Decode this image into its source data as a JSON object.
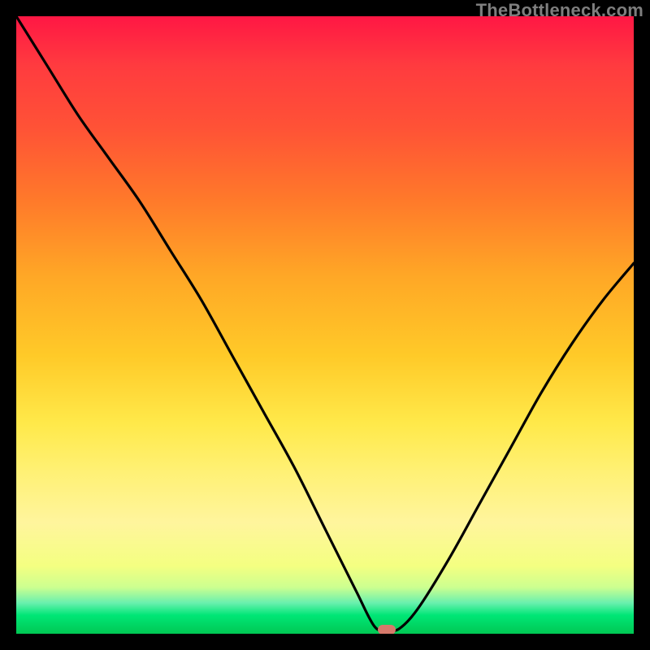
{
  "watermark": "TheBottleneck.com",
  "marker": {
    "x_pct": 60.0,
    "y_pct": 99.4,
    "color": "#d6796b"
  },
  "chart_data": {
    "type": "line",
    "title": "",
    "xlabel": "",
    "ylabel": "",
    "xlim": [
      0,
      100
    ],
    "ylim": [
      0,
      100
    ],
    "grid": false,
    "legend": false,
    "series": [
      {
        "name": "bottleneck-curve",
        "x": [
          0,
          5,
          10,
          15,
          20,
          25,
          30,
          35,
          40,
          45,
          50,
          55,
          58,
          60,
          62,
          65,
          70,
          75,
          80,
          85,
          90,
          95,
          100
        ],
        "values": [
          100,
          92,
          84,
          77,
          70,
          62,
          54,
          45,
          36,
          27,
          17,
          7,
          1.2,
          0.6,
          0.8,
          4,
          12,
          21,
          30,
          39,
          47,
          54,
          60
        ]
      }
    ],
    "annotations": [
      {
        "type": "marker",
        "x": 60,
        "y": 0.6,
        "shape": "pill",
        "color": "#d6796b"
      }
    ],
    "background_gradient": {
      "direction": "vertical",
      "stops": [
        {
          "pct": 0,
          "color": "#ff1744"
        },
        {
          "pct": 18,
          "color": "#ff5236"
        },
        {
          "pct": 42,
          "color": "#ffa726"
        },
        {
          "pct": 66,
          "color": "#ffe94a"
        },
        {
          "pct": 89,
          "color": "#f4ff81"
        },
        {
          "pct": 95,
          "color": "#69f0ae"
        },
        {
          "pct": 100,
          "color": "#00c853"
        }
      ]
    }
  }
}
